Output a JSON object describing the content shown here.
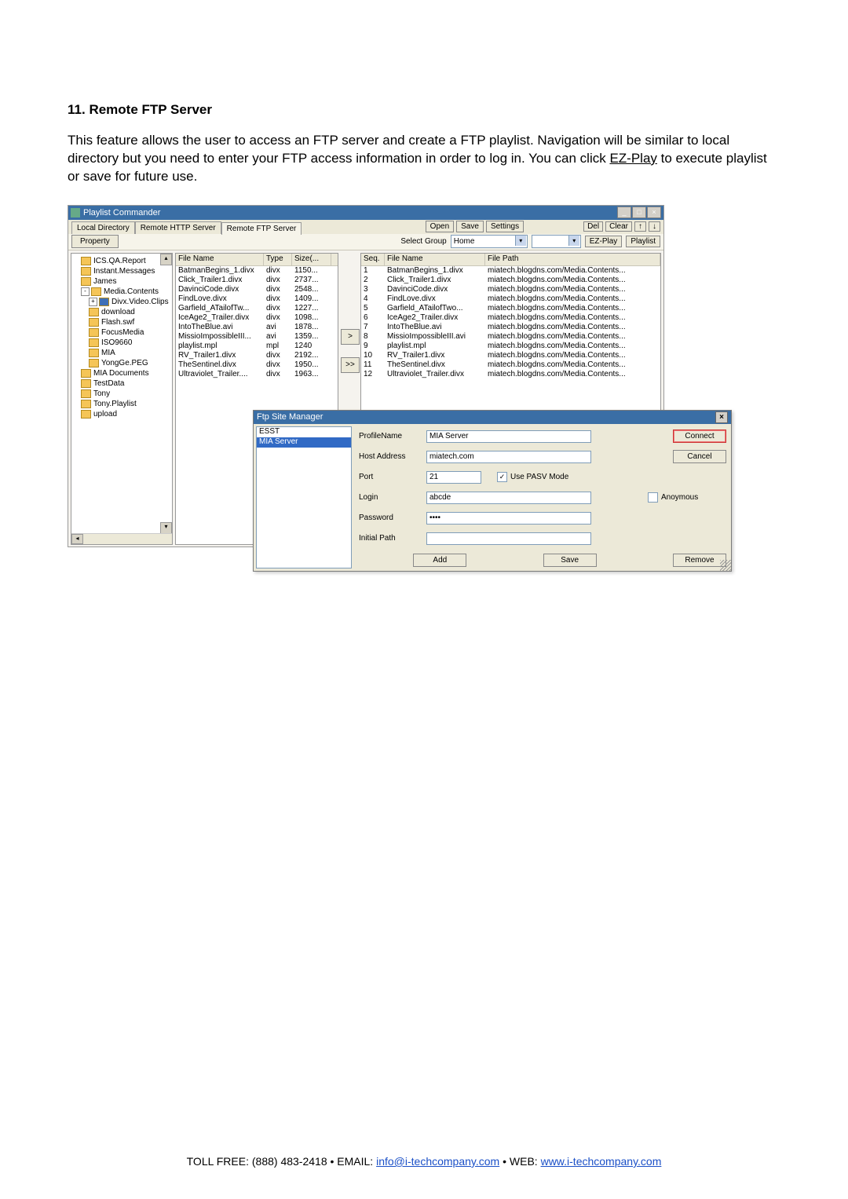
{
  "section": {
    "number": "11.",
    "title": "Remote FTP Server"
  },
  "paragraph": "This feature allows the user to access an FTP server and create a FTP playlist. Navigation will be similar to local directory but you need to enter your FTP access information in order to log in. You can click ",
  "paragraph_link": "EZ-Play",
  "paragraph_tail": " to execute playlist or save for future use.",
  "window": {
    "title": "Playlist Commander",
    "tabs": [
      "Local Directory",
      "Remote HTTP Server",
      "Remote FTP Server"
    ],
    "active_tab": 2,
    "toolbar": {
      "open": "Open",
      "save": "Save",
      "settings": "Settings",
      "del": "Del",
      "clear": "Clear",
      "up": "↑",
      "down": "↓"
    },
    "row2": {
      "property": "Property",
      "select_group": "Select Group",
      "group_value": "Home",
      "ezplay": "EZ-Play",
      "playlist": "Playlist"
    },
    "tree": [
      {
        "indent": 1,
        "label": "ICS.QA.Report"
      },
      {
        "indent": 1,
        "label": "Instant.Messages"
      },
      {
        "indent": 1,
        "label": "James"
      },
      {
        "indent": 1,
        "label": "Media.Contents",
        "expander": "-",
        "open": true
      },
      {
        "indent": 2,
        "label": "Divx.Video.Clips",
        "expander": "+",
        "sel": true
      },
      {
        "indent": 2,
        "label": "download"
      },
      {
        "indent": 2,
        "label": "Flash.swf"
      },
      {
        "indent": 2,
        "label": "FocusMedia"
      },
      {
        "indent": 2,
        "label": "ISO9660"
      },
      {
        "indent": 2,
        "label": "MIA"
      },
      {
        "indent": 2,
        "label": "YongGe.PEG"
      },
      {
        "indent": 1,
        "label": "MIA Documents"
      },
      {
        "indent": 1,
        "label": "TestData"
      },
      {
        "indent": 1,
        "label": "Tony"
      },
      {
        "indent": 1,
        "label": "Tony.Playlist"
      },
      {
        "indent": 1,
        "label": "upload"
      }
    ],
    "file_cols": {
      "c1": "File Name",
      "c2": "Type",
      "c3": "Size(..."
    },
    "files": [
      {
        "n": "BatmanBegins_1.divx",
        "t": "divx",
        "s": "1150..."
      },
      {
        "n": "Click_Trailer1.divx",
        "t": "divx",
        "s": "2737..."
      },
      {
        "n": "DavinciCode.divx",
        "t": "divx",
        "s": "2548..."
      },
      {
        "n": "FindLove.divx",
        "t": "divx",
        "s": "1409..."
      },
      {
        "n": "Garfield_ATailofTw...",
        "t": "divx",
        "s": "1227..."
      },
      {
        "n": "IceAge2_Trailer.divx",
        "t": "divx",
        "s": "1098..."
      },
      {
        "n": "IntoTheBlue.avi",
        "t": "avi",
        "s": "1878..."
      },
      {
        "n": "MissioImpossibleIII...",
        "t": "avi",
        "s": "1359..."
      },
      {
        "n": "playlist.mpl",
        "t": "mpl",
        "s": "1240"
      },
      {
        "n": "RV_Trailer1.divx",
        "t": "divx",
        "s": "2192..."
      },
      {
        "n": "TheSentinel.divx",
        "t": "divx",
        "s": "1950..."
      },
      {
        "n": "Ultraviolet_Trailer....",
        "t": "divx",
        "s": "1963..."
      }
    ],
    "transfer": {
      "single": ">",
      "all": ">>"
    },
    "play_cols": {
      "c1": "Seq.",
      "c2": "File Name",
      "c3": "File Path"
    },
    "playlist": [
      {
        "i": "1",
        "n": "BatmanBegins_1.divx",
        "p": "miatech.blogdns.com/Media.Contents..."
      },
      {
        "i": "2",
        "n": "Click_Trailer1.divx",
        "p": "miatech.blogdns.com/Media.Contents..."
      },
      {
        "i": "3",
        "n": "DavinciCode.divx",
        "p": "miatech.blogdns.com/Media.Contents..."
      },
      {
        "i": "4",
        "n": "FindLove.divx",
        "p": "miatech.blogdns.com/Media.Contents..."
      },
      {
        "i": "5",
        "n": "Garfield_ATailofTwo...",
        "p": "miatech.blogdns.com/Media.Contents..."
      },
      {
        "i": "6",
        "n": "IceAge2_Trailer.divx",
        "p": "miatech.blogdns.com/Media.Contents..."
      },
      {
        "i": "7",
        "n": "IntoTheBlue.avi",
        "p": "miatech.blogdns.com/Media.Contents..."
      },
      {
        "i": "8",
        "n": "MissioImpossibleIII.avi",
        "p": "miatech.blogdns.com/Media.Contents..."
      },
      {
        "i": "9",
        "n": "playlist.mpl",
        "p": "miatech.blogdns.com/Media.Contents..."
      },
      {
        "i": "10",
        "n": "RV_Trailer1.divx",
        "p": "miatech.blogdns.com/Media.Contents..."
      },
      {
        "i": "11",
        "n": "TheSentinel.divx",
        "p": "miatech.blogdns.com/Media.Contents..."
      },
      {
        "i": "12",
        "n": "Ultraviolet_Trailer.divx",
        "p": "miatech.blogdns.com/Media.Contents..."
      }
    ]
  },
  "dialog": {
    "title": "Ftp Site Manager",
    "profiles": [
      "ESST",
      "MIA Server"
    ],
    "sel": 1,
    "labels": {
      "profile": "ProfileName",
      "host": "Host Address",
      "port": "Port",
      "login": "Login",
      "password": "Password",
      "initial": "Initial Path"
    },
    "values": {
      "profile": "MIA Server",
      "host": "miatech.com",
      "port": "21",
      "login": "abcde",
      "password": "••••"
    },
    "checks": {
      "pasv": "Use PASV Mode",
      "anon": "Anoymous"
    },
    "buttons": {
      "connect": "Connect",
      "cancel": "Cancel",
      "add": "Add",
      "save": "Save",
      "remove": "Remove"
    }
  },
  "footer": {
    "toll": "TOLL FREE: (888) 483-2418 • EMAIL: ",
    "email": "info@i-techcompany.com",
    "mid": " • WEB: ",
    "web": "www.i-techcompany.com"
  }
}
